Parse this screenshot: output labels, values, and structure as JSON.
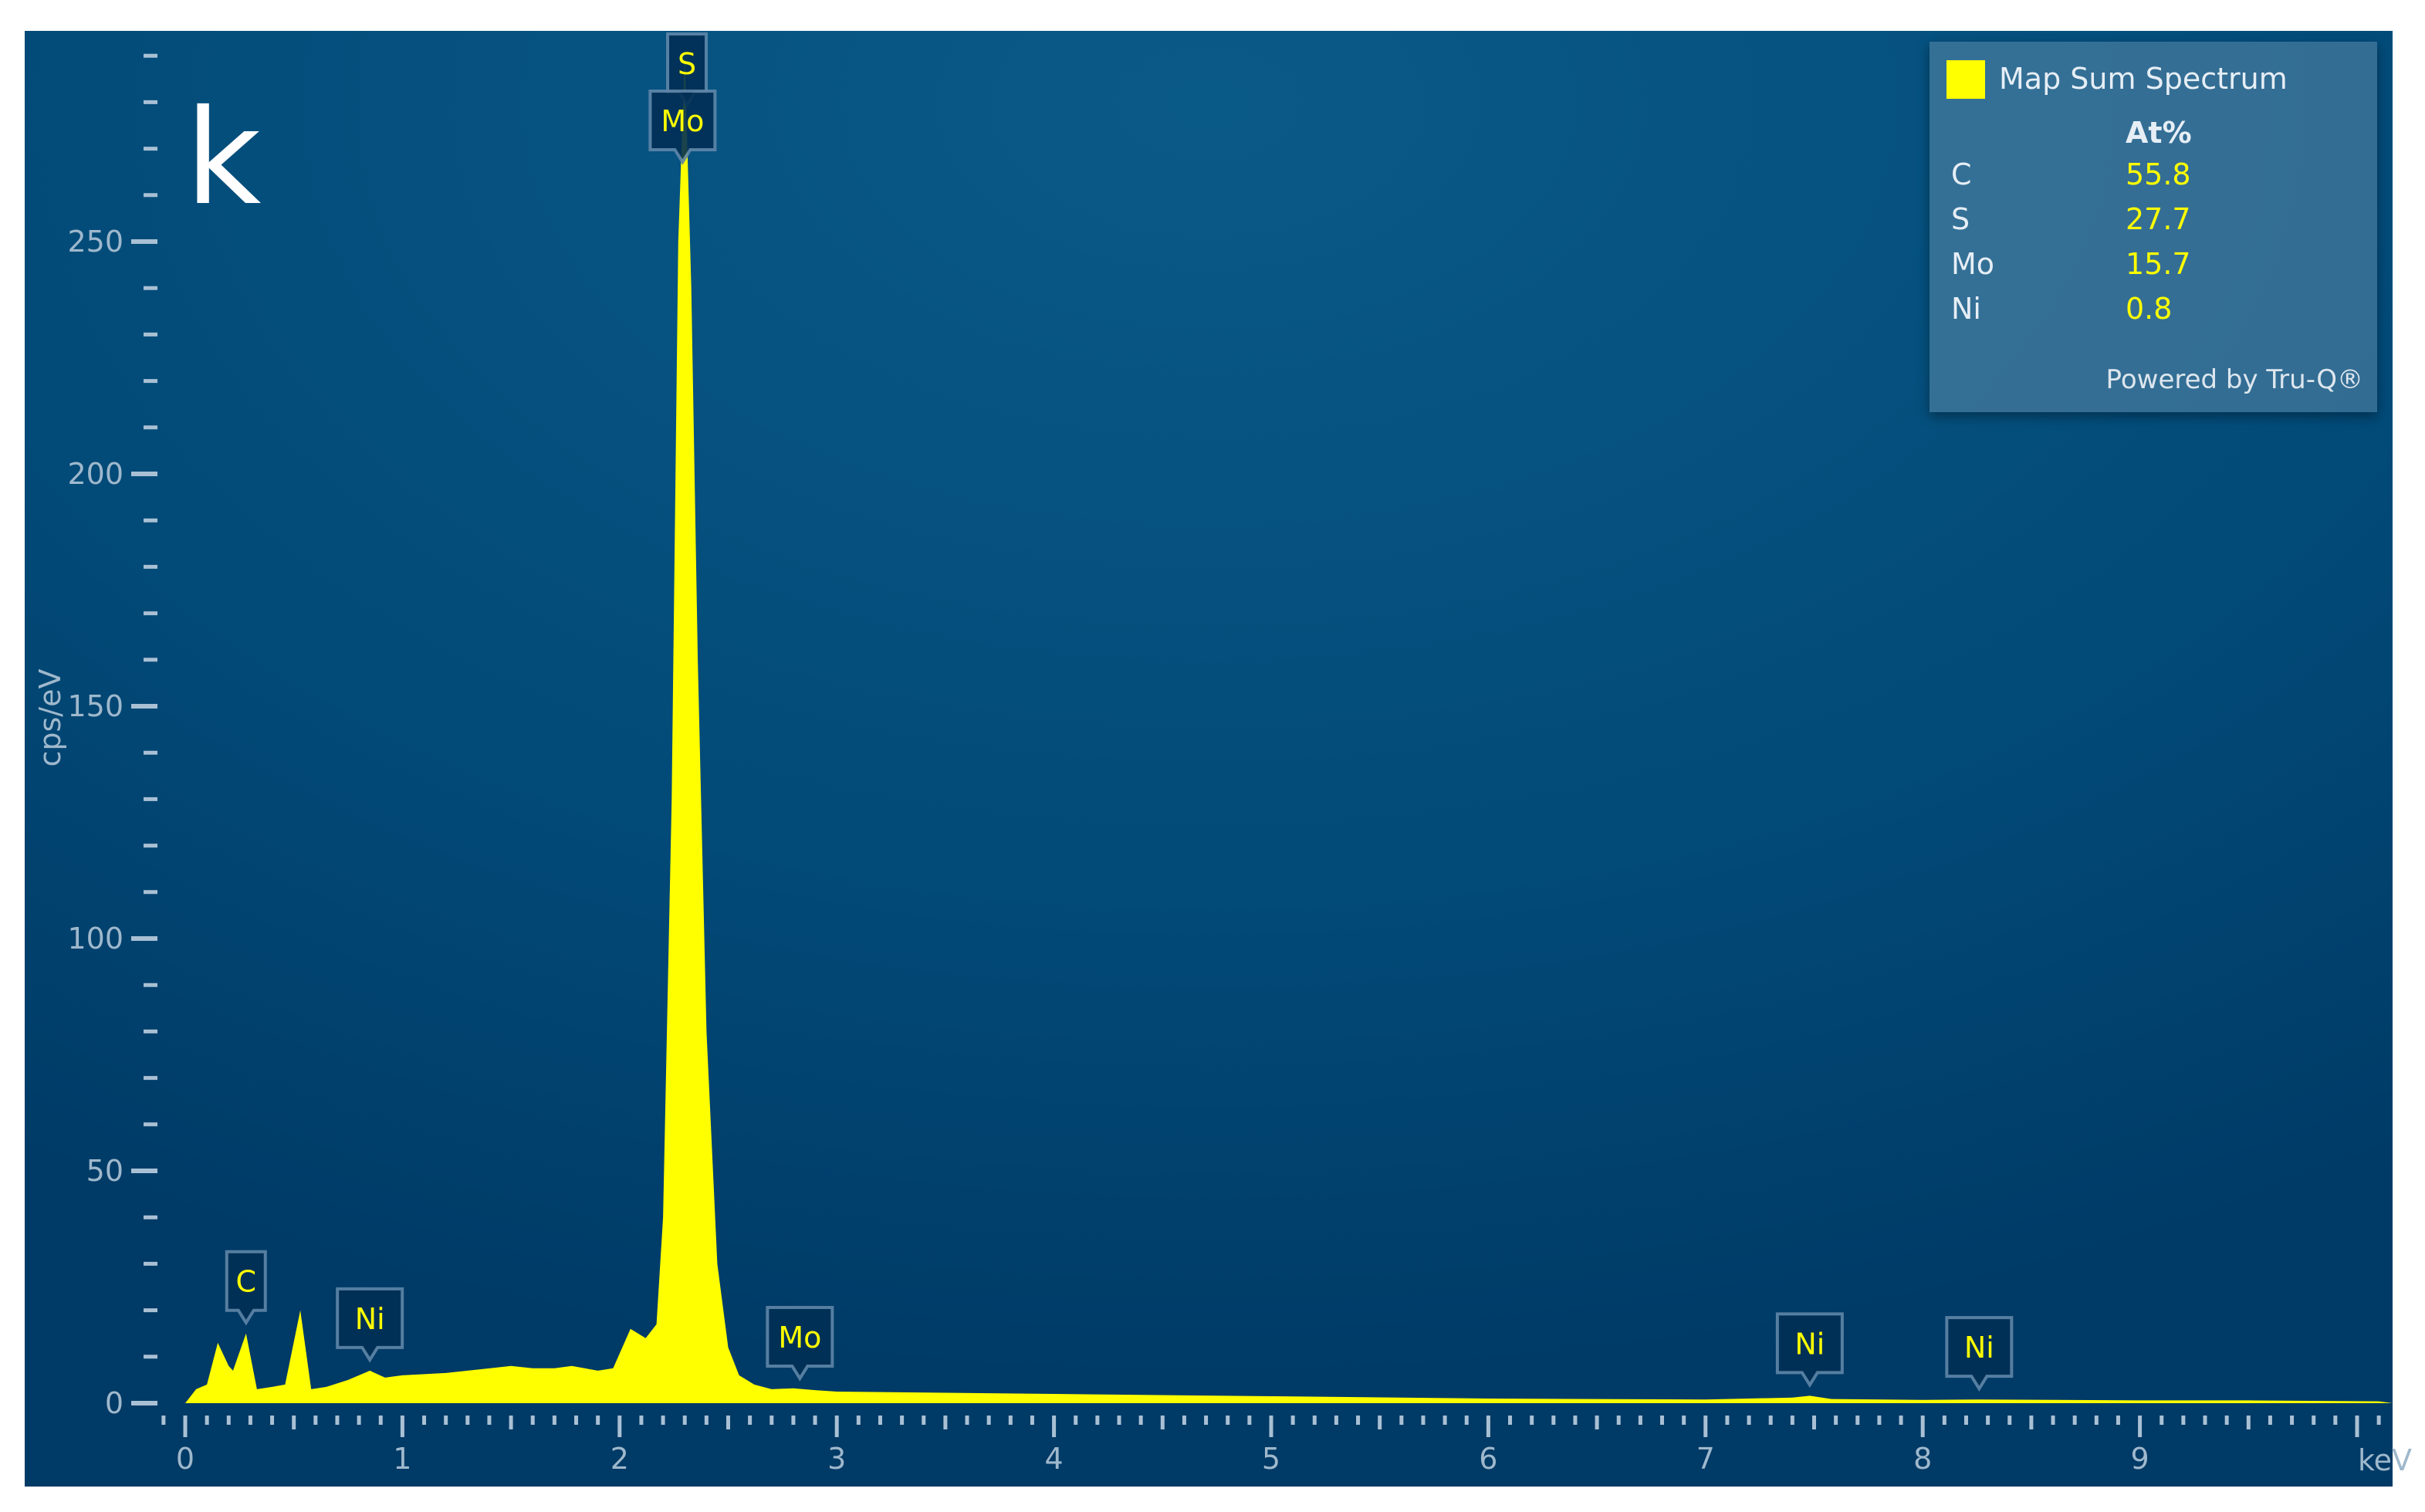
{
  "panel_label": "k",
  "chart_data": {
    "type": "area",
    "title": "",
    "xlabel": "keV",
    "ylabel": "cps/eV",
    "xlim": [
      0,
      10.1
    ],
    "ylim": [
      0,
      290
    ],
    "x_ticks": [
      0,
      1,
      2,
      3,
      4,
      5,
      6,
      7,
      8,
      9
    ],
    "y_ticks": [
      0,
      50,
      100,
      150,
      200,
      250
    ],
    "series": [
      {
        "name": "Map Sum Spectrum",
        "color": "#ffff00",
        "x": [
          0,
          0.05,
          0.1,
          0.15,
          0.2,
          0.22,
          0.28,
          0.33,
          0.4,
          0.46,
          0.53,
          0.58,
          0.65,
          0.75,
          0.85,
          0.92,
          1.0,
          1.2,
          1.5,
          1.6,
          1.7,
          1.78,
          1.9,
          1.97,
          2.05,
          2.12,
          2.17,
          2.2,
          2.24,
          2.27,
          2.3,
          2.33,
          2.36,
          2.4,
          2.45,
          2.5,
          2.55,
          2.62,
          2.7,
          2.8,
          2.9,
          3.0,
          4.0,
          5.0,
          6.0,
          7.0,
          7.4,
          7.48,
          7.58,
          8.0,
          8.26,
          9.0,
          9.5,
          10.1
        ],
        "y": [
          0,
          3,
          4,
          13,
          8,
          7,
          15,
          3,
          3.5,
          4,
          20,
          3,
          3.5,
          5,
          7,
          5.5,
          6,
          6.5,
          8,
          7.5,
          7.5,
          8,
          7,
          7.5,
          16,
          14,
          17,
          40,
          130,
          250,
          290,
          240,
          160,
          80,
          30,
          12,
          6,
          4,
          3,
          3.2,
          2.8,
          2.5,
          2,
          1.5,
          1,
          0.8,
          1.2,
          1.6,
          0.9,
          0.7,
          0.8,
          0.6,
          0.6,
          0.4
        ]
      }
    ],
    "peak_labels": [
      {
        "element": "C",
        "x": 0.28,
        "y": 15
      },
      {
        "element": "Ni",
        "x": 0.85,
        "y": 7
      },
      {
        "element": "S",
        "x": 2.31,
        "y": 290
      },
      {
        "element": "Mo",
        "x": 2.29,
        "y": 290
      },
      {
        "element": "Mo",
        "x": 2.83,
        "y": 3
      },
      {
        "element": "Ni",
        "x": 7.48,
        "y": 1.6
      },
      {
        "element": "Ni",
        "x": 8.26,
        "y": 0.8
      }
    ],
    "grid": false,
    "legend_position": "top-right"
  },
  "legend": {
    "series_name": "Map Sum Spectrum",
    "column_header": "At%",
    "rows": [
      {
        "element": "C",
        "value": "55.8"
      },
      {
        "element": "S",
        "value": "27.7"
      },
      {
        "element": "Mo",
        "value": "15.7"
      },
      {
        "element": "Ni",
        "value": "0.8"
      }
    ],
    "footer": "Powered by Tru-Q®"
  }
}
